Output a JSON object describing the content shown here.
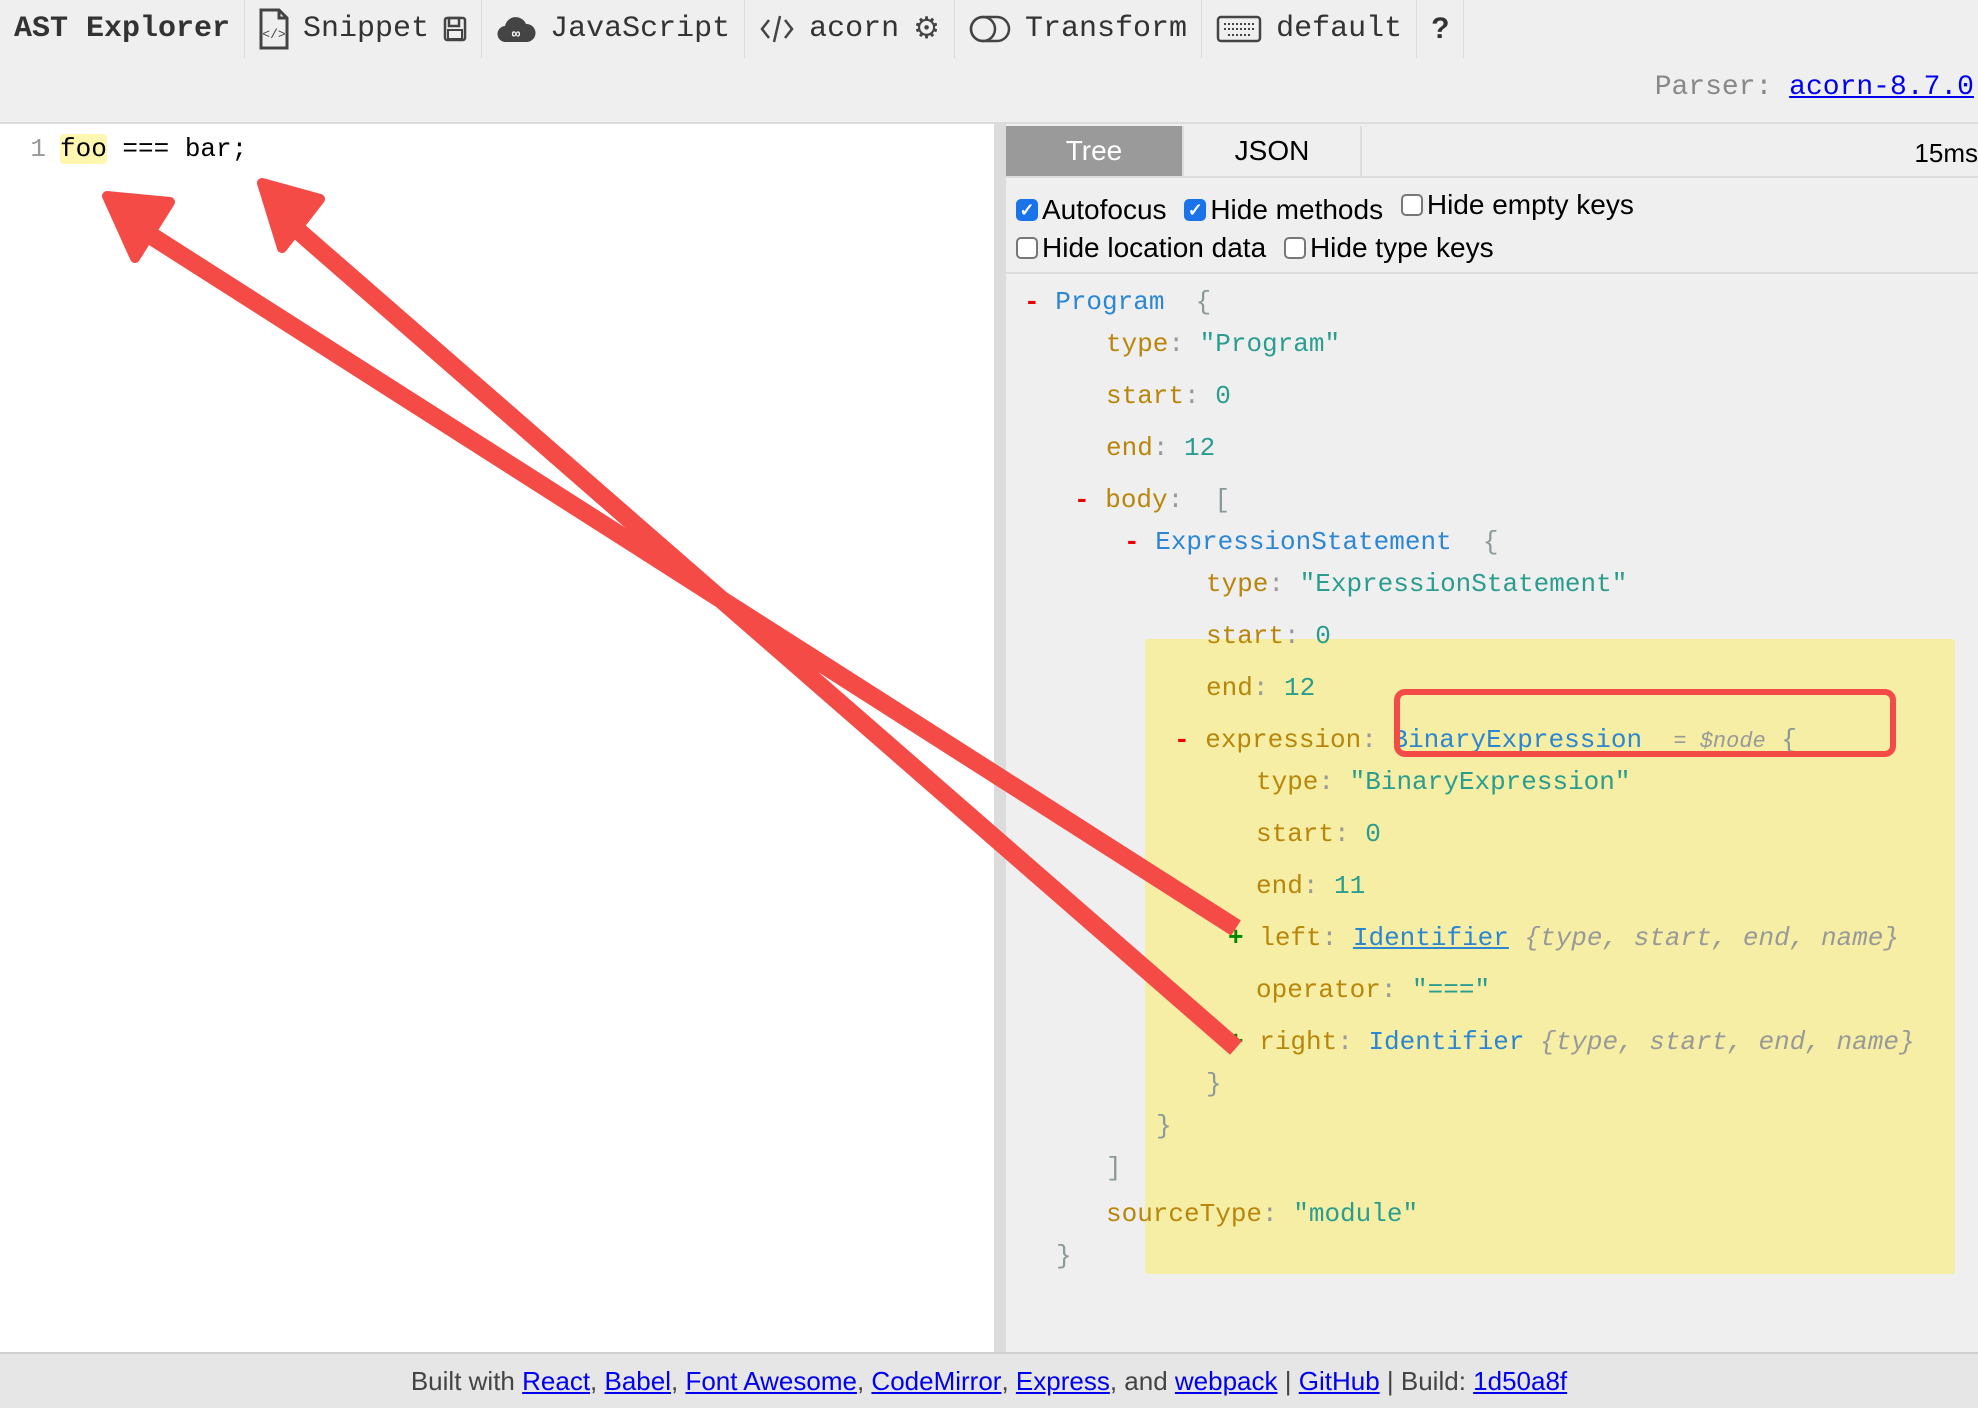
{
  "toolbar": {
    "title": "AST Explorer",
    "items": [
      {
        "icon": "file-code-icon",
        "label": "Snippet"
      },
      {
        "icon": "save-icon",
        "label": ""
      },
      {
        "icon": "cloud-icon",
        "label": "JavaScript"
      },
      {
        "icon": "code-icon",
        "label": "acorn"
      },
      {
        "icon": "gear-icon",
        "label": ""
      },
      {
        "icon": "toggle-icon",
        "label": "Transform"
      },
      {
        "icon": "keyboard-icon",
        "label": "default"
      },
      {
        "icon": "help-icon",
        "label": "?"
      }
    ]
  },
  "parser": {
    "label": "Parser:",
    "value": "acorn-8.7.0"
  },
  "editor": {
    "lines": [
      {
        "number": "1",
        "highlighted": "foo",
        "rest": " === bar;"
      }
    ]
  },
  "output": {
    "tabs": [
      {
        "label": "Tree",
        "active": true
      },
      {
        "label": "JSON",
        "active": false
      }
    ],
    "timing": "15ms",
    "options": [
      {
        "label": "Autofocus",
        "checked": true
      },
      {
        "label": "Hide methods",
        "checked": true
      },
      {
        "label": "Hide empty keys",
        "checked": false
      },
      {
        "label": "Hide location data",
        "checked": false
      },
      {
        "label": "Hide type keys",
        "checked": false
      }
    ],
    "tree": {
      "program": {
        "toggle": "-",
        "type": "Program",
        "open": "{"
      },
      "program_type": {
        "key": "type",
        "value": "\"Program\""
      },
      "program_start": {
        "key": "start",
        "value": "0"
      },
      "program_end": {
        "key": "end",
        "value": "12"
      },
      "body": {
        "toggle": "-",
        "key": "body",
        "open": "["
      },
      "exprstmt": {
        "toggle": "-",
        "type": "ExpressionStatement",
        "open": "{"
      },
      "es_type": {
        "key": "type",
        "value": "\"ExpressionStatement\""
      },
      "es_start": {
        "key": "start",
        "value": "0"
      },
      "es_end": {
        "key": "end",
        "value": "12"
      },
      "expression": {
        "toggle": "-",
        "key": "expression",
        "type": "BinaryExpression",
        "suffix": "= $node",
        "open": "{"
      },
      "be_type": {
        "key": "type",
        "value": "\"BinaryExpression\""
      },
      "be_start": {
        "key": "start",
        "value": "0"
      },
      "be_end": {
        "key": "end",
        "value": "11"
      },
      "left": {
        "toggle": "+",
        "key": "left",
        "type": "Identifier",
        "summary": "{type, start, end, name}"
      },
      "operator": {
        "key": "operator",
        "value": "\"===\""
      },
      "right": {
        "toggle": "+",
        "key": "right",
        "type": "Identifier",
        "summary": "{type, start, end, name}"
      },
      "close_be": "}",
      "close_es": "}",
      "close_body": "]",
      "source_type": {
        "key": "sourceType",
        "value": "\"module\""
      },
      "close_program": "}"
    }
  },
  "footer": {
    "prefix": "Built with",
    "links": [
      "React",
      "Babel",
      "Font Awesome",
      "CodeMirror",
      "Express"
    ],
    "and": ", and",
    "webpack": "webpack",
    "sep": "|",
    "github": "GitHub",
    "build_label": "| Build:",
    "build": "1d50a8f"
  },
  "annotations": {
    "color": "#f44b47"
  }
}
